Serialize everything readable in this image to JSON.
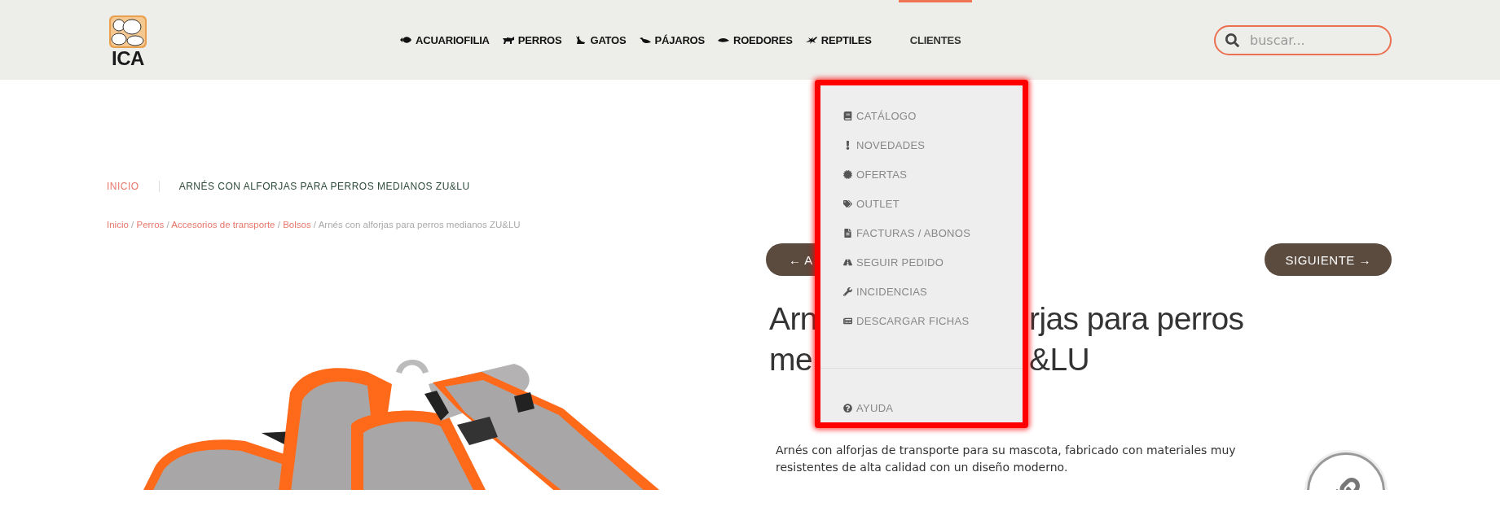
{
  "header": {
    "logo_text": "ICA",
    "nav": [
      {
        "label": "ACUARIOFILIA",
        "kind": "fish",
        "selected": false
      },
      {
        "label": "PERROS",
        "kind": "dog",
        "selected": false
      },
      {
        "label": "GATOS",
        "kind": "cat",
        "selected": false
      },
      {
        "label": "PÁJAROS",
        "kind": "bird",
        "selected": false
      },
      {
        "label": "ROEDORES",
        "kind": "rodent",
        "selected": false
      },
      {
        "label": "REPTILES",
        "kind": "reptile",
        "selected": false
      },
      {
        "label": "CLIENTES",
        "kind": "plain",
        "selected": true
      }
    ],
    "search": {
      "placeholder": "buscar..."
    }
  },
  "dropdown": {
    "items": [
      {
        "label": "CATÁLOGO",
        "kind": "book"
      },
      {
        "label": "NOVEDADES",
        "kind": "exclamation"
      },
      {
        "label": "OFERTAS",
        "kind": "certificate"
      },
      {
        "label": "OUTLET",
        "kind": "tags"
      },
      {
        "label": "FACTURAS / ABONOS",
        "kind": "file"
      },
      {
        "label": "SEGUIR PEDIDO",
        "kind": "road"
      },
      {
        "label": "INCIDENCIAS",
        "kind": "wrench"
      },
      {
        "label": "DESCARGAR FICHAS",
        "kind": "newspaper"
      }
    ],
    "footer_item": {
      "label": "AYUDA",
      "kind": "question"
    }
  },
  "tabs": [
    {
      "label": "INICIO",
      "selected": false
    },
    {
      "label": "ARNÉS CON ALFORJAS PARA PERROS MEDIANOS ZU&LU",
      "selected": true
    }
  ],
  "breadcrumb": {
    "links": [
      "Inicio",
      "Perros",
      "Accesorios de transporte",
      "Bolsos"
    ],
    "separator": "/",
    "current": "Arnés con alforjas para perros medianos ZU&LU"
  },
  "product": {
    "prev_button": "← A",
    "next_button": "SIGUIENTE →",
    "title_lines": [
      [
        "Arn",
        "rjas para perros"
      ],
      [
        "me",
        "&LU"
      ]
    ],
    "description": "Arnés con alforjas de transporte para su mascota, fabricado con materiales muy resistentes de alta calidad con un diseño moderno."
  }
}
